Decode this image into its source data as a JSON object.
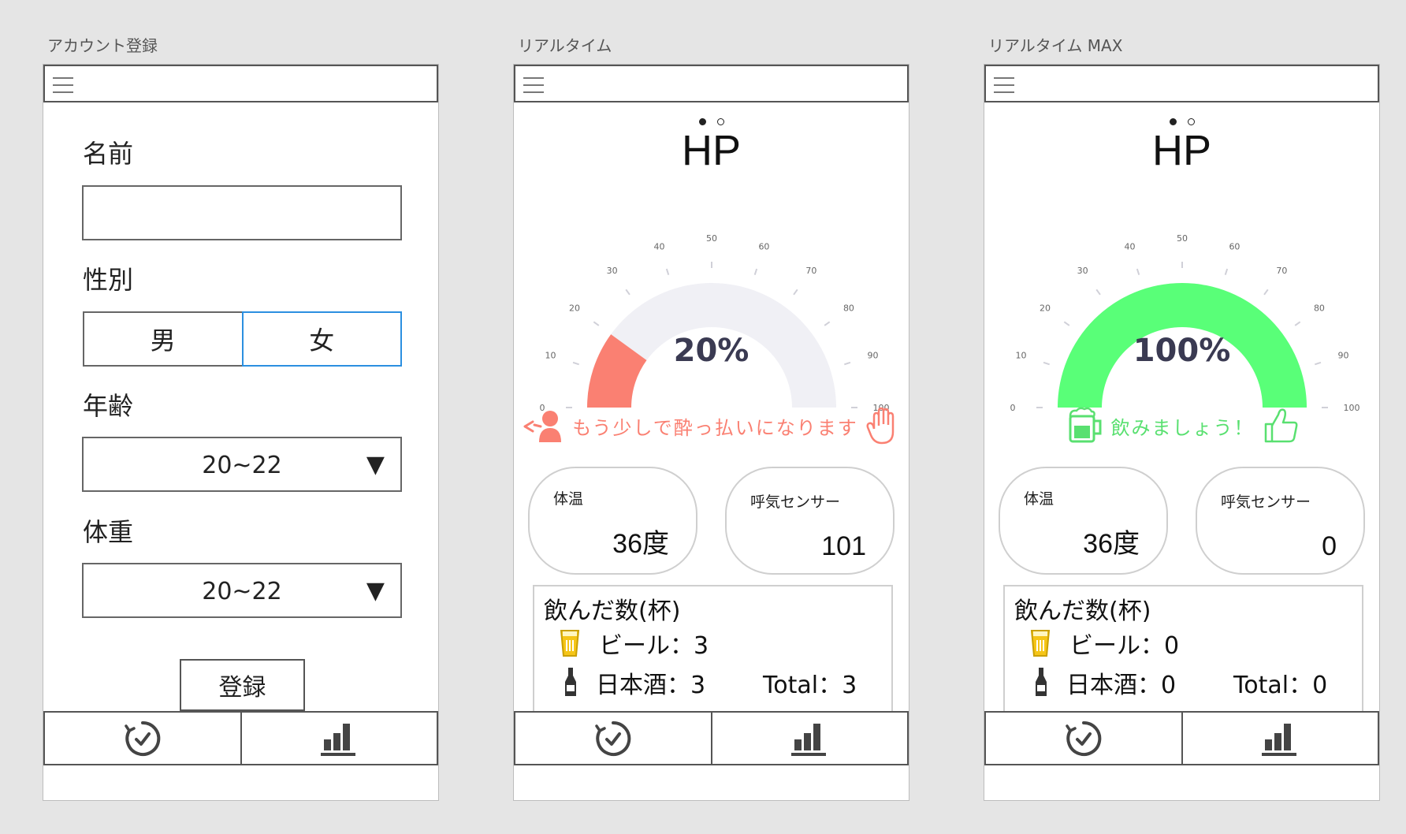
{
  "screens": {
    "account": {
      "label": "アカウント登録",
      "fields": {
        "name_label": "名前",
        "gender_label": "性別",
        "gender_male": "男",
        "gender_female": "女",
        "age_label": "年齢",
        "age_value": "20~22",
        "weight_label": "体重",
        "weight_value": "20~22",
        "dropdown_arrow": "▼"
      },
      "register_button": "登録",
      "selected_gender": "女"
    },
    "realtime": {
      "label": "リアルタイム",
      "title": "HP",
      "gauge": {
        "value": 20,
        "display": "20%",
        "color": "#fa8072",
        "track_color": "#f0f0f5"
      },
      "status": {
        "text": "もう少しで酔っ払いになります",
        "color": "#fa8072"
      },
      "body_temp": {
        "label": "体温",
        "value": "36度"
      },
      "breath_sensor": {
        "label": "呼気センサー",
        "value": "101"
      },
      "drinks": {
        "title": "飲んだ数(杯)",
        "beer": "ビール：3",
        "sake": "日本酒：3",
        "total": "Total：3"
      }
    },
    "realtime_max": {
      "label": "リアルタイム MAX",
      "title": "HP",
      "gauge": {
        "value": 100,
        "display": "100%",
        "color": "#59ff78",
        "track_color": "#f0f0f5"
      },
      "status": {
        "text": "飲みましょう！",
        "color": "#59e070"
      },
      "body_temp": {
        "label": "体温",
        "value": "36度"
      },
      "breath_sensor": {
        "label": "呼気センサー",
        "value": "0"
      },
      "drinks": {
        "title": "飲んだ数(杯)",
        "beer": "ビール：0",
        "sake": "日本酒：0",
        "total": "Total：0"
      }
    }
  },
  "gauge_ticks": [
    "0",
    "10",
    "20",
    "30",
    "40",
    "50",
    "60",
    "70",
    "80",
    "90",
    "100"
  ],
  "icons": {
    "menu": "hamburger-icon",
    "timer": "timer-icon",
    "stats": "bar-chart-icon",
    "beer": "beer-glass-icon",
    "sake": "sake-bottle-icon",
    "warning": "drunk-face-icon",
    "stop": "stop-hand-icon",
    "mug": "beer-mug-icon",
    "thumbs": "thumbs-up-icon"
  }
}
